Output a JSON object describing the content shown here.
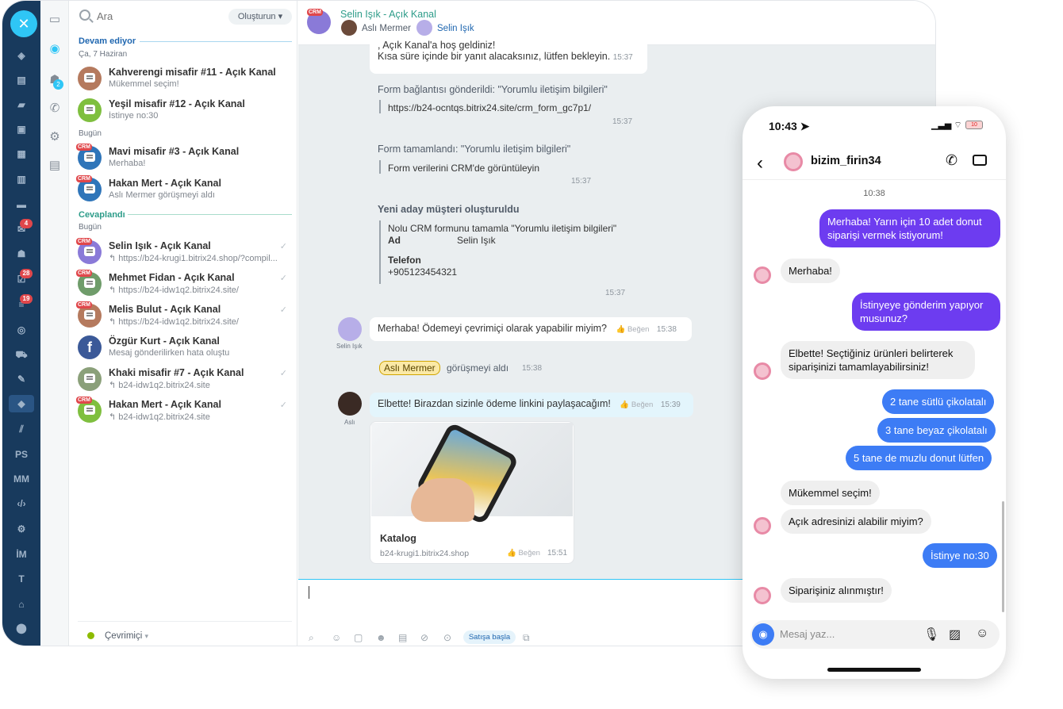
{
  "leftbar": {
    "items": [
      {
        "label": "●",
        "top": 0
      },
      {
        "label": "PS"
      },
      {
        "label": "MM"
      },
      {
        "label": "İM"
      },
      {
        "label": "T"
      }
    ],
    "badges": [
      "4",
      "28",
      "19"
    ]
  },
  "iconcol": {
    "badge": "2"
  },
  "chatlist": {
    "search_placeholder": "Ara",
    "create_label": "Oluşturun",
    "section_ongoing": "Devam ediyor",
    "date_1": "Ça, 7 Haziran",
    "date_today": "Bugün",
    "section_answered": "Cevaplandı",
    "date_today_2": "Bugün",
    "items": [
      {
        "title": "Kahverengi misafir #11 - Açık Kanal",
        "sub": "Mükemmel seçim!",
        "color": "#b57a5e"
      },
      {
        "title": "Yeşil misafir #12 - Açık Kanal",
        "sub": "İstinye no:30",
        "color": "#7fbf3f"
      },
      {
        "title": "Mavi misafir #3 - Açık Kanal",
        "sub": "Merhaba!",
        "color": "#2f75b9",
        "crm": "CRM"
      },
      {
        "title": "Hakan Mert - Açık Kanal",
        "sub": "Aslı Mermer görüşmeyi aldı",
        "color": "#2f75b9",
        "crm": "CRM"
      },
      {
        "title": "Selin Işık - Açık Kanal",
        "sub": "https://b24-krugi1.bitrix24.shop/?compil...",
        "color": "#8a7ad8",
        "crm": "CRM"
      },
      {
        "title": "Mehmet Fidan - Açık Kanal",
        "sub": "https://b24-idw1q2.bitrix24.site/",
        "color": "#6f9c6a",
        "crm": "CRM"
      },
      {
        "title": "Melis Bulut - Açık Kanal",
        "sub": "https://b24-idw1q2.bitrix24.site/",
        "color": "#b57a5e",
        "crm": "CRM"
      },
      {
        "title": "Özgür Kurt - Açık Kanal",
        "sub": "Mesaj gönderilirken hata oluştu",
        "color": "#3b5998"
      },
      {
        "title": "Khaki misafir #7 - Açık Kanal",
        "sub": "b24-idw1q2.bitrix24.site",
        "color": "#8ba07a"
      },
      {
        "title": "Hakan Mert - Açık Kanal",
        "sub": "b24-idw1q2.bitrix24.site",
        "color": "#7fbf3f",
        "crm": "CRM"
      }
    ],
    "status": "Çevrimiçi"
  },
  "chat": {
    "title": "Selin Işık - Açık Kanal",
    "user1": "Aslı Mermer",
    "user2": "Selin Işık",
    "welcome_1": ", Açık Kanal'a hoş geldiniz!",
    "welcome_2": "Kısa süre içinde bir yanıt alacaksınız, lütfen bekleyin.",
    "welcome_time": "15:37",
    "form_sent": "Form bağlantısı gönderildi: \"Yorumlu iletişim bilgileri\"",
    "form_link": "https://b24-ocntqs.bitrix24.site/crm_form_gc7p1/",
    "form_sent_time": "15:37",
    "form_done": "Form tamamlandı: \"Yorumlu iletişim bilgileri\"",
    "form_done_text": "Form verilerini CRM'de görüntüleyin",
    "form_done_time": "15:37",
    "new_client": "Yeni aday müşteri oluşturuldu",
    "crm_line": "Nolu CRM formunu tamamla \"Yorumlu iletişim bilgileri\"",
    "ad_label": "Ad",
    "ad_value": "Selin Işık",
    "phone_label": "Telefon",
    "phone_value": "+905123454321",
    "new_client_time": "15:37",
    "msg1": "Merhaba! Ödemeyi çevrimiçi olarak yapabilir miyim?",
    "msg1_name": "Selin Işık",
    "like": "Beğen",
    "msg1_time": "15:38",
    "took_name": "Aslı Mermer",
    "took_text": "görüşmeyi aldı",
    "took_time": "15:38",
    "msg2": "Elbette! Birazdan sizinle ödeme linkini paylaşacağım!",
    "msg2_name": "Aslı",
    "msg2_time": "15:39",
    "card_title": "Katalog",
    "card_link": "b24-krugi1.bitrix24.shop",
    "card_time": "15:51",
    "sale_button": "Satışa başla"
  },
  "phone": {
    "time": "10:43",
    "battery": "10",
    "contact": "bizim_firin34",
    "stamp": "10:38",
    "messages": [
      {
        "dir": "out",
        "text": "Merhaba! Yarın için 10 adet donut siparişi vermek istiyorum!"
      },
      {
        "dir": "in",
        "text": "Merhaba!"
      },
      {
        "dir": "out",
        "text": "İstinyeye gönderim yapıyor musunuz?"
      },
      {
        "dir": "in",
        "text": "Elbette! Seçtiğiniz ürünleri belirterek siparişinizi tamamlayabilirsiniz!"
      },
      {
        "dir": "out",
        "text": "2 tane sütlü çikolatalı"
      },
      {
        "dir": "out",
        "text": "3 tane beyaz çikolatalı"
      },
      {
        "dir": "out",
        "text": "5 tane de muzlu donut lütfen"
      },
      {
        "dir": "in",
        "text": "Mükemmel seçim!"
      },
      {
        "dir": "in",
        "text": "Açık adresinizi alabilir miyim?"
      },
      {
        "dir": "out",
        "text": "İstinye no:30"
      },
      {
        "dir": "in",
        "text": "Siparişiniz alınmıştır!"
      }
    ],
    "input_placeholder": "Mesaj yaz..."
  }
}
